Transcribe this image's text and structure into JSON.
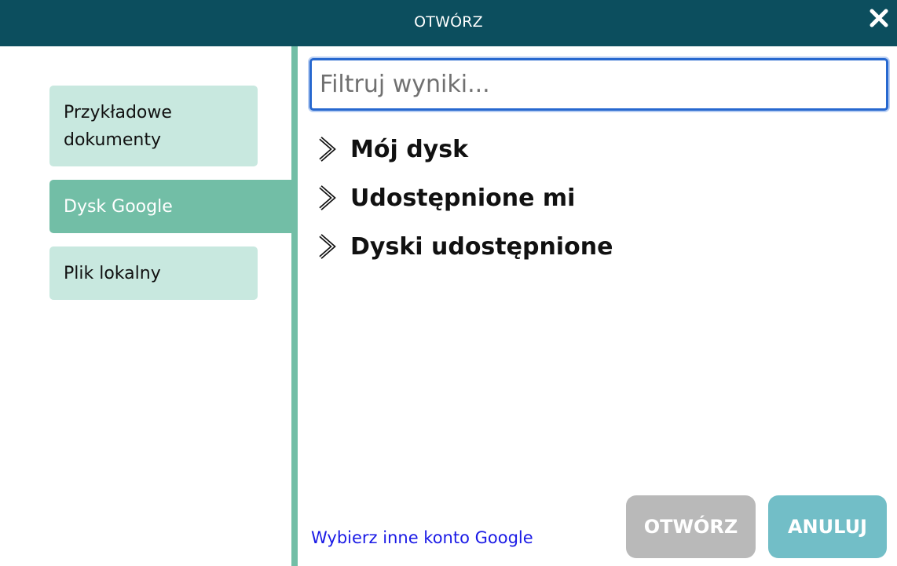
{
  "dialog": {
    "title": "OTWÓRZ"
  },
  "sidebar": {
    "items": [
      {
        "label": "Przykładowe dokumenty",
        "active": false
      },
      {
        "label": "Dysk Google",
        "active": true
      },
      {
        "label": "Plik lokalny",
        "active": false
      }
    ]
  },
  "filter": {
    "placeholder": "Filtruj wyniki...",
    "value": ""
  },
  "tree": {
    "items": [
      {
        "label": "Mój dysk",
        "icon": "chevron-right-icon"
      },
      {
        "label": "Udostępnione mi",
        "icon": "chevron-right-icon"
      },
      {
        "label": "Dyski udostępnione",
        "icon": "chevron-right-icon"
      }
    ]
  },
  "footer": {
    "account_link": "Wybierz inne konto Google",
    "open_label": "OTWÓRZ",
    "cancel_label": "ANULUJ"
  },
  "colors": {
    "titlebar": "#0c4e5e",
    "sidebar_item": "#c8e8df",
    "sidebar_active": "#72bea6",
    "focus_border": "#2768cf",
    "link": "#1a1ae6",
    "open_disabled": "#b9b9b9",
    "cancel": "#72bec7"
  }
}
